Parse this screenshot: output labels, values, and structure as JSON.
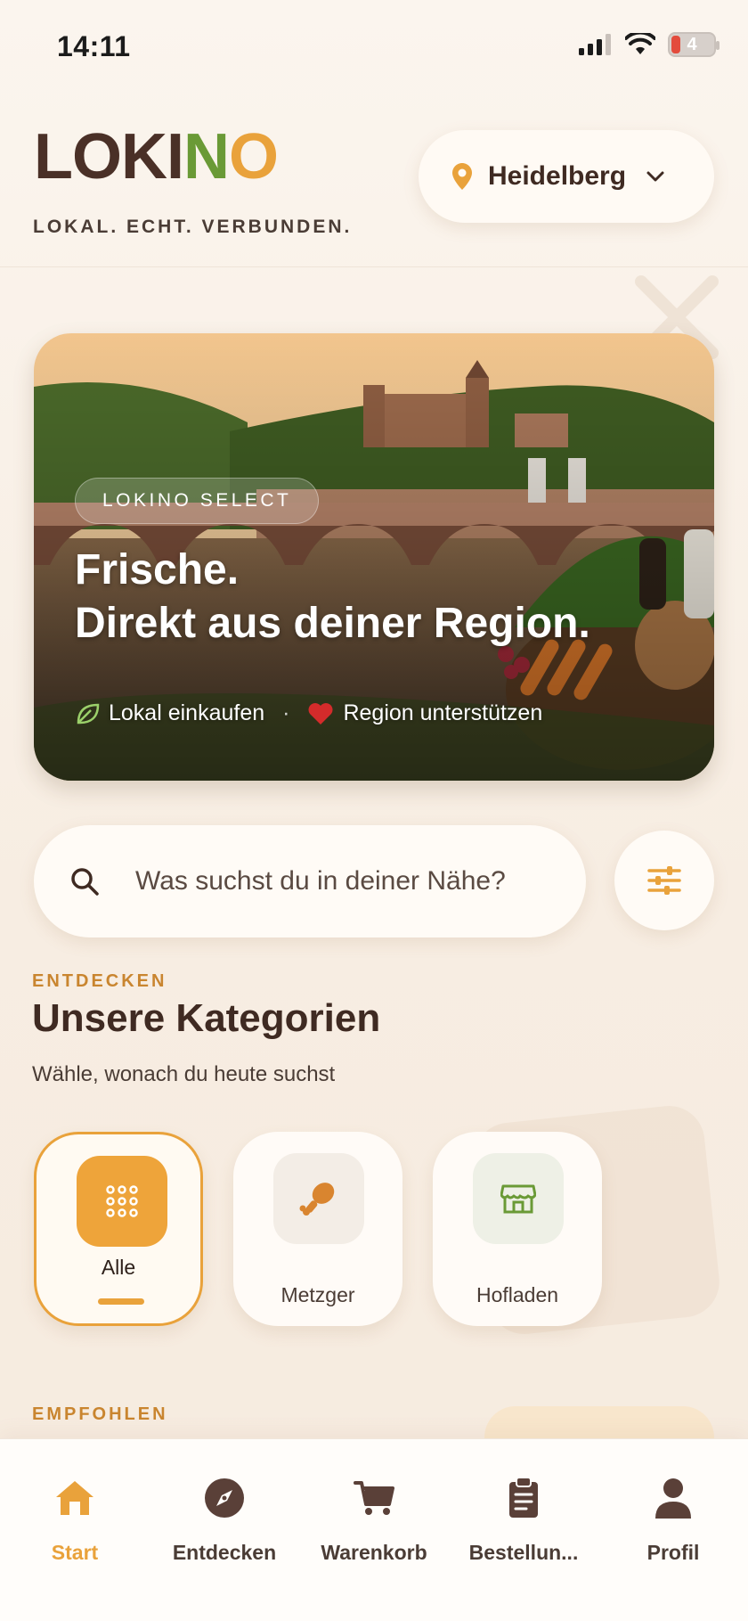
{
  "status_bar": {
    "time": "14:11",
    "battery": "4"
  },
  "header": {
    "logo_part1": "LOKI",
    "logo_part2": "N",
    "logo_part3": "O",
    "tagline": "LOKAL. ECHT. VERBUNDEN.",
    "location": "Heidelberg"
  },
  "hero": {
    "badge": "LOKINO SELECT",
    "title_line1": "Frische.",
    "title_line2": "Direkt aus deiner Region.",
    "feature1": "Lokal einkaufen",
    "feature2": "Region unterstützen"
  },
  "search": {
    "placeholder": "Was suchst du in deiner Nähe?"
  },
  "categories": {
    "eyebrow": "ENTDECKEN",
    "title": "Unsere Kategorien",
    "subtitle": "Wähle, wonach du heute suchst",
    "items": [
      {
        "label": "Alle",
        "icon": "grid-icon",
        "active": true
      },
      {
        "label": "Metzger",
        "icon": "drumstick-icon",
        "active": false
      },
      {
        "label": "Hofladen",
        "icon": "storefront-icon",
        "active": false
      }
    ]
  },
  "recommended": {
    "eyebrow": "EMPFOHLEN"
  },
  "bottom_nav": {
    "items": [
      {
        "label": "Start",
        "icon": "home-icon",
        "active": true
      },
      {
        "label": "Entdecken",
        "icon": "compass-icon",
        "active": false
      },
      {
        "label": "Warenkorb",
        "icon": "cart-icon",
        "active": false
      },
      {
        "label": "Bestellun...",
        "icon": "clipboard-icon",
        "active": false
      },
      {
        "label": "Profil",
        "icon": "user-icon",
        "active": false
      }
    ]
  },
  "colors": {
    "accent": "#e9a23b",
    "brand_dark": "#4a3027",
    "brand_green": "#6a9a36"
  }
}
